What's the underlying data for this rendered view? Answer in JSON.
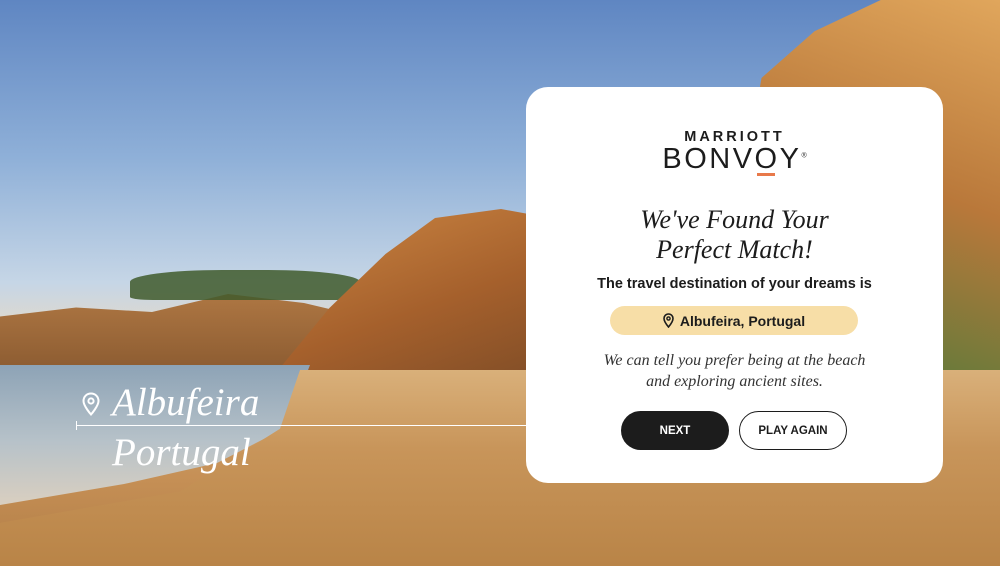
{
  "location_overlay": {
    "city": "Albufeira",
    "country": "Portugal",
    "icon": "map-pin-icon"
  },
  "card": {
    "brand": {
      "top": "MARRIOTT",
      "main": "BONVOY",
      "registered": "®"
    },
    "headline_line1": "We've Found Your",
    "headline_line2": "Perfect Match!",
    "subheading": "The travel destination of your dreams is",
    "destination": {
      "icon": "map-pin-icon",
      "label": "Albufeira, Portugal"
    },
    "description_line1": "We can tell you prefer being at the beach",
    "description_line2": "and exploring ancient sites.",
    "buttons": {
      "next": "NEXT",
      "play_again": "PLAY AGAIN"
    }
  },
  "colors": {
    "pill": "#f7dea7",
    "brand_accent": "#e8794a",
    "primary_button": "#1c1c1c"
  }
}
